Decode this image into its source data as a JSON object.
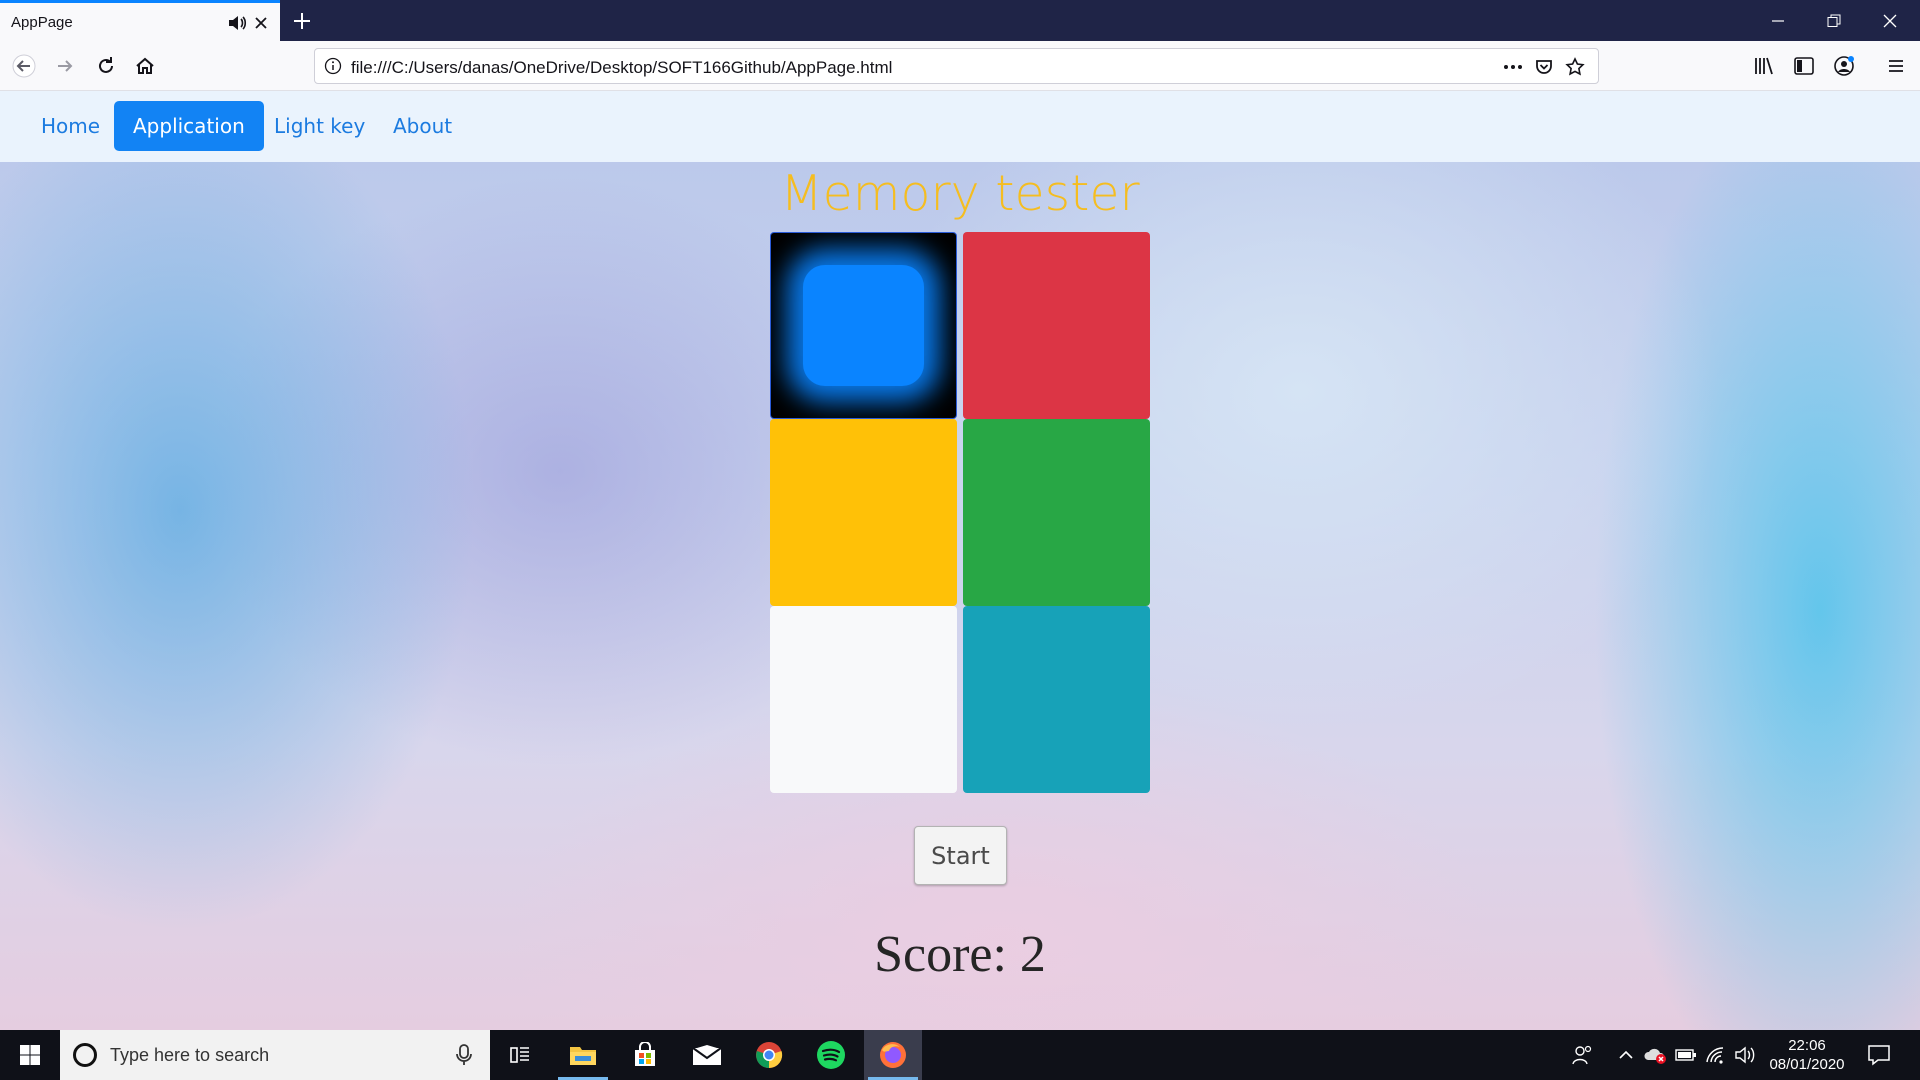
{
  "browser": {
    "tab_title": "AppPage",
    "url": "file:///C:/Users/danas/OneDrive/Desktop/SOFT166Github/AppPage.html",
    "accent_color": "#0a84ff"
  },
  "site_nav": {
    "items": [
      {
        "label": "Home",
        "active": false
      },
      {
        "label": "Application",
        "active": true
      },
      {
        "label": "Light key",
        "active": false
      },
      {
        "label": "About",
        "active": false
      }
    ]
  },
  "game": {
    "title": "Memory tester",
    "tiles": [
      {
        "color_name": "blue",
        "color": "#0a84ff",
        "lit": true
      },
      {
        "color_name": "red",
        "color": "#dc3545",
        "lit": false
      },
      {
        "color_name": "yellow",
        "color": "#ffc107",
        "lit": false
      },
      {
        "color_name": "green",
        "color": "#28a745",
        "lit": false
      },
      {
        "color_name": "white",
        "color": "#f8f9fa",
        "lit": false
      },
      {
        "color_name": "teal",
        "color": "#17a2b8",
        "lit": false
      }
    ],
    "start_label": "Start",
    "score_text": "Score: 2"
  },
  "taskbar": {
    "search_placeholder": "Type here to search",
    "apps": [
      "task-view",
      "file-explorer",
      "microsoft-store",
      "mail",
      "chrome",
      "spotify",
      "firefox"
    ],
    "time": "22:06",
    "date": "08/01/2020"
  }
}
